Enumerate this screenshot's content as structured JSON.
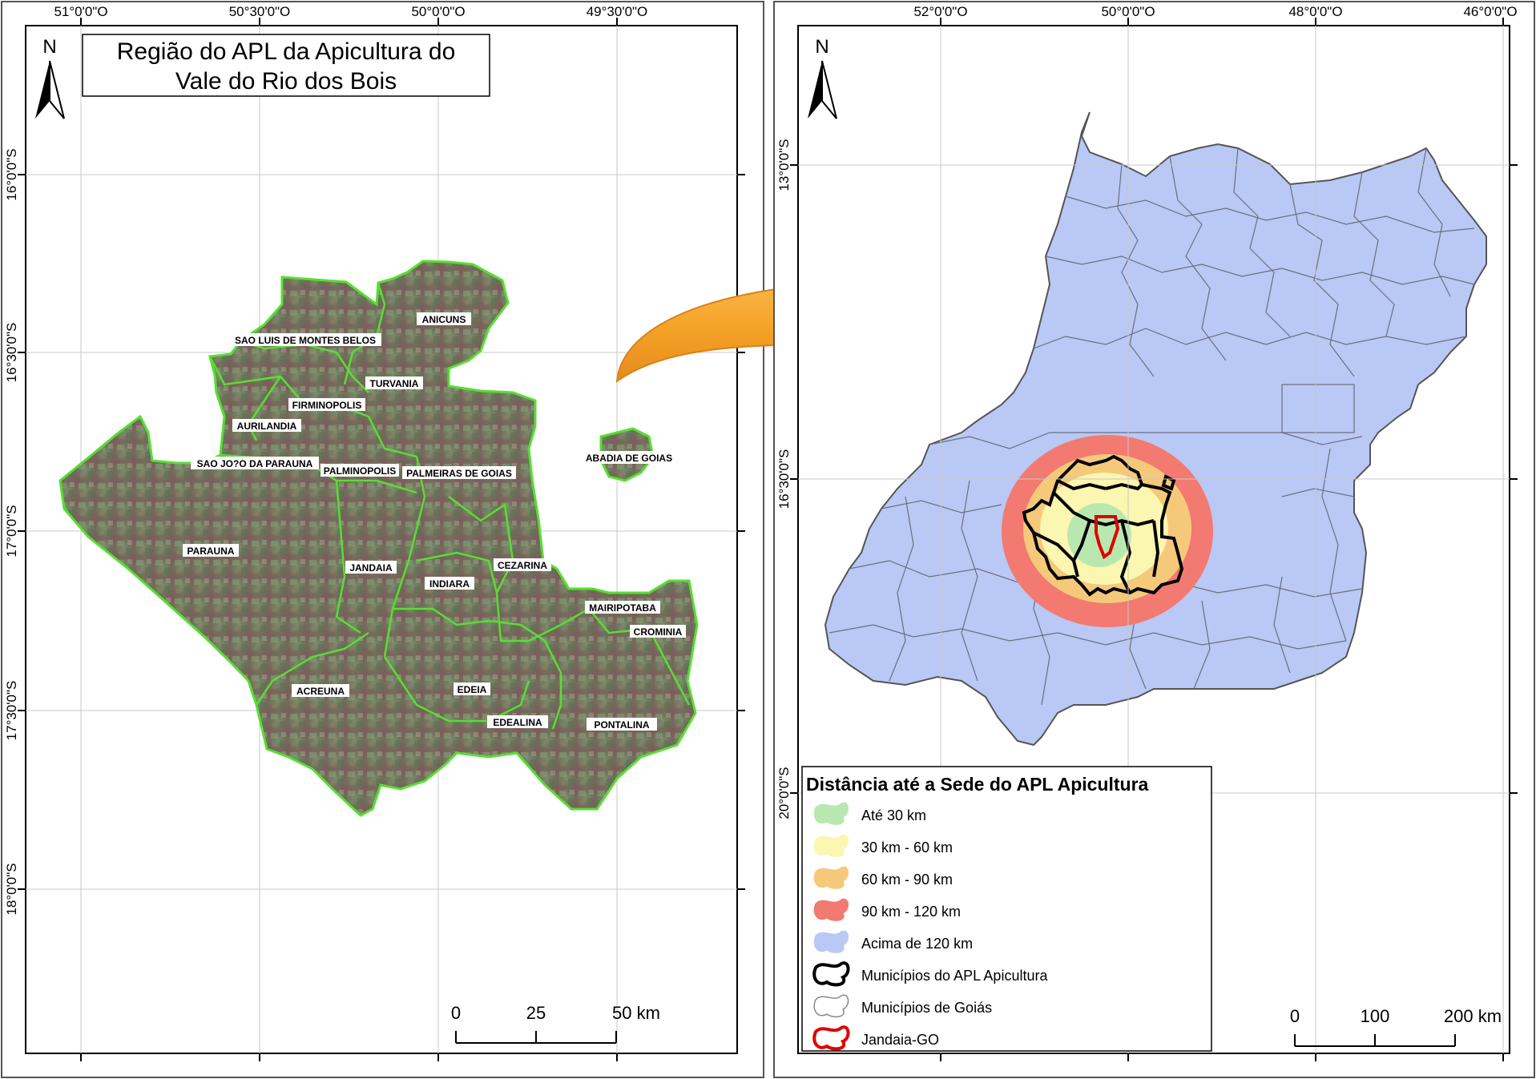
{
  "left_map": {
    "title_line1": "Região do APL da Apicultura do",
    "title_line2": "Vale do Rio dos Bois",
    "north_label": "N",
    "lon_labels": [
      "51°0'0\"O",
      "50°30'0\"O",
      "50°0'0\"O",
      "49°30'0\"O"
    ],
    "lat_labels": [
      "16°0'0\"S",
      "16°30'0\"S",
      "17°0'0\"S",
      "17°30'0\"S",
      "18°0'0\"S"
    ],
    "municipalities": [
      "ANICUNS",
      "SAO LUIS DE MONTES BELOS",
      "TURVANIA",
      "FIRMINOPOLIS",
      "AURILANDIA",
      "SAO JO?O DA PARAUNA",
      "PALMINOPOLIS",
      "PALMEIRAS DE GOIAS",
      "ABADIA DE GOIAS",
      "PARAUNA",
      "JANDAIA",
      "CEZARINA",
      "INDIARA",
      "MAIRIPOTABA",
      "CROMINIA",
      "ACREUNA",
      "EDEIA",
      "EDEALINA",
      "PONTALINA"
    ],
    "scale_ticks": [
      "0",
      "25",
      "50 km"
    ]
  },
  "right_map": {
    "north_label": "N",
    "lon_labels": [
      "52°0'0\"O",
      "50°0'0\"O",
      "48°0'0\"O",
      "46°0'0\"O"
    ],
    "lat_labels": [
      "13°0'0\"S",
      "16°30'0\"S",
      "20°0'0\"S"
    ],
    "scale_ticks": [
      "0",
      "100",
      "200 km"
    ],
    "legend": {
      "title": "Distância até a Sede do APL Apicultura",
      "items": [
        {
          "label": "Até 30 km",
          "color": "#b8e8b0"
        },
        {
          "label": "30 km - 60 km",
          "color": "#fbf6b0"
        },
        {
          "label": "60 km - 90 km",
          "color": "#f5c97a"
        },
        {
          "label": "90 km - 120 km",
          "color": "#f27a70"
        },
        {
          "label": "Acima de 120 km",
          "color": "#b9c8f5"
        },
        {
          "label": "Municípios do APL Apicultura",
          "color": "#000000"
        },
        {
          "label": "Municípios de Goiás",
          "color": "#888888"
        },
        {
          "label": "Jandaia-GO",
          "color": "#e00000"
        }
      ]
    }
  }
}
